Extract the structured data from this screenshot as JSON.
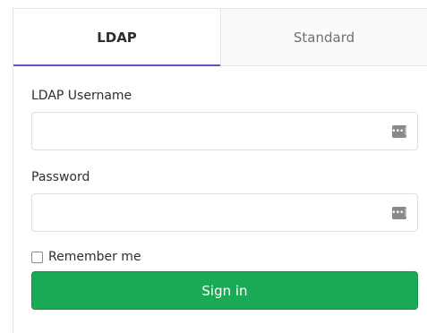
{
  "tabs": [
    {
      "label": "LDAP",
      "active": true
    },
    {
      "label": "Standard",
      "active": false
    }
  ],
  "form": {
    "username_label": "LDAP Username",
    "username_value": "",
    "username_placeholder": "",
    "password_label": "Password",
    "password_value": "",
    "password_placeholder": "",
    "remember_label": "Remember me",
    "remember_checked": false,
    "submit_label": "Sign in"
  },
  "icons": {
    "password_manager": "password-manager-icon"
  },
  "colors": {
    "active_tab_underline": "#6b4fbb",
    "submit_bg": "#1aaa55",
    "submit_border": "#168f48"
  }
}
